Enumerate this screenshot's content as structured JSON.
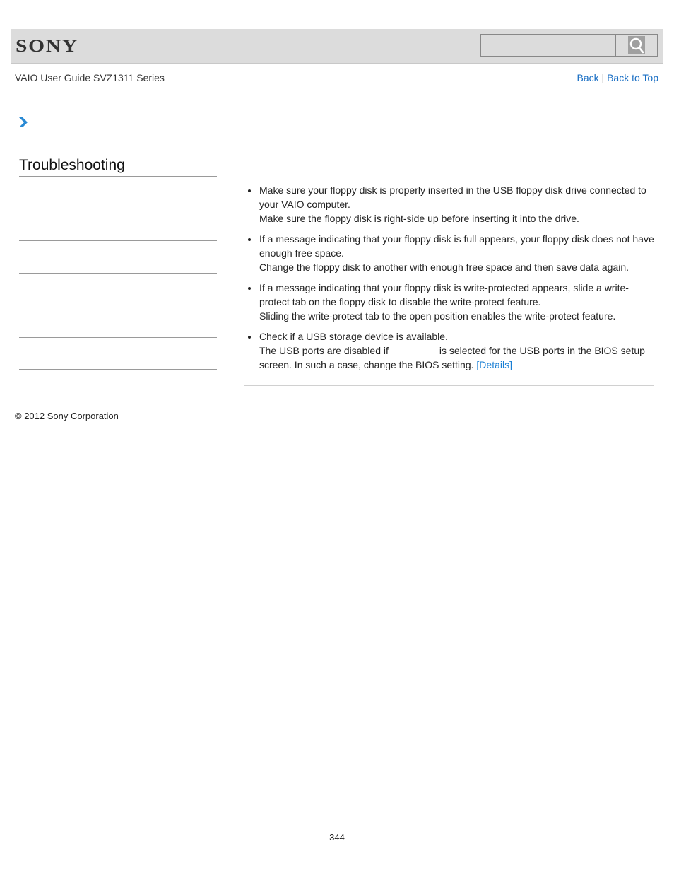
{
  "header": {
    "logo": "SONY",
    "search": {
      "placeholder": "",
      "value": ""
    },
    "search_icon": "magnifier-icon"
  },
  "subheader": {
    "guide_title": "VAIO User Guide SVZ1311 Series",
    "back_label": "Back",
    "separator": "|",
    "back_to_top_label": "Back to Top"
  },
  "breadcrumb": {
    "icon": "chevron-right-icon"
  },
  "sidebar": {
    "title": "Troubleshooting",
    "items": [
      "",
      "",
      "",
      "",
      "",
      ""
    ]
  },
  "content": {
    "bullets": [
      {
        "main": "Make sure your floppy disk is properly inserted in the USB floppy disk drive connected to your VAIO computer.",
        "detail": "Make sure the floppy disk is right-side up before inserting it into the drive."
      },
      {
        "main": "If a message indicating that your floppy disk is full appears, your floppy disk does not have enough free space.",
        "detail": "Change the floppy disk to another with enough free space and then save data again."
      },
      {
        "main": "If a message indicating that your floppy disk is write-protected appears, slide a write-protect tab on the floppy disk to disable the write-protect feature.",
        "detail": "Sliding the write-protect tab to the open position enables the write-protect feature."
      },
      {
        "main": "Check if a USB storage device is available.",
        "detail_pre": "The USB ports are disabled if",
        "detail_post": "is selected for the USB ports in the BIOS setup screen. In such a case, change the BIOS setting.",
        "link": "[Details]"
      }
    ]
  },
  "footer": {
    "copyright": "© 2012 Sony Corporation",
    "page_number": "344"
  },
  "colors": {
    "header_bg": "#dcdcdc",
    "link": "#1a6fc4",
    "chevron": "#2a8ad4"
  }
}
